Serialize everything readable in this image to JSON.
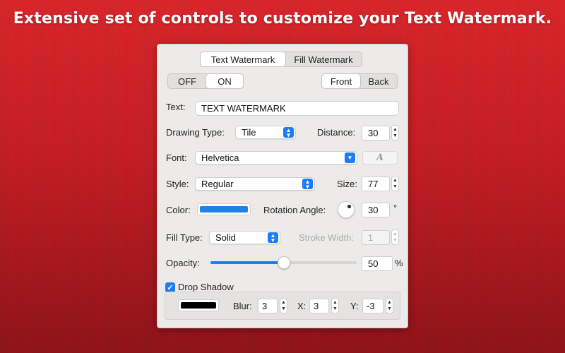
{
  "headline": "Extensive set of controls to customize your Text Watermark.",
  "tabs": [
    {
      "label": "Text Watermark",
      "selected": true
    },
    {
      "label": "Fill Watermark",
      "selected": false
    }
  ],
  "power_toggle": {
    "off": "OFF",
    "on": "ON",
    "selected": "ON"
  },
  "layer_toggle": {
    "front": "Front",
    "back": "Back",
    "selected": "Front"
  },
  "text": {
    "label": "Text:",
    "value": "TEXT WATERMARK"
  },
  "drawing_type": {
    "label": "Drawing Type:",
    "value": "Tile"
  },
  "distance": {
    "label": "Distance:",
    "value": "30"
  },
  "font": {
    "label": "Font:",
    "value": "Helvetica",
    "button_glyph": "A"
  },
  "style": {
    "label": "Style:",
    "value": "Regular"
  },
  "size": {
    "label": "Size:",
    "value": "77"
  },
  "color": {
    "label": "Color:",
    "swatch": "#1f83e6"
  },
  "rotation": {
    "label": "Rotation Angle:",
    "value": "30",
    "unit": "°"
  },
  "fill_type": {
    "label": "Fill Type:",
    "value": "Solid"
  },
  "stroke_width": {
    "label": "Stroke Width:",
    "value": "1"
  },
  "opacity": {
    "label": "Opacity:",
    "value": "50",
    "unit": "%",
    "fraction": 0.5
  },
  "drop_shadow": {
    "label": "Drop Shadow",
    "checked": true,
    "swatch": "#000000",
    "blur_label": "Blur:",
    "blur": "3",
    "x_label": "X:",
    "x": "3",
    "y_label": "Y:",
    "y": "-3"
  },
  "colors": {
    "accent": "#1e7cf5",
    "background_red": "#c41e24"
  }
}
